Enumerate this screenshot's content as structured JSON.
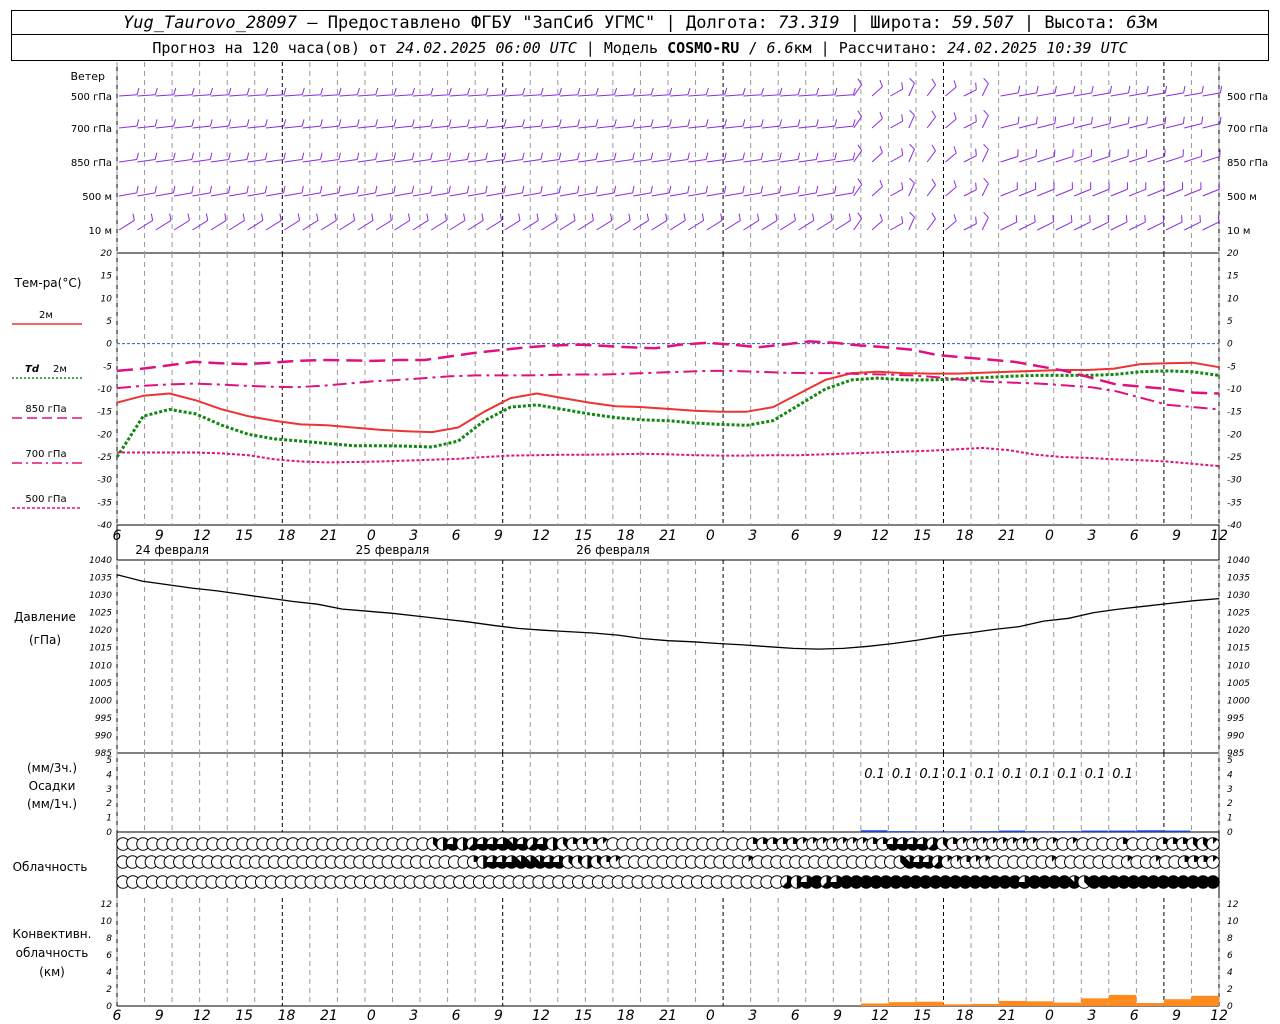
{
  "header": {
    "station": "Yug_Taurovo_28097",
    "provider": "– Предоставлено ФГБУ \"ЗапСиб УГМС\"",
    "lon_label": "Долгота:",
    "lon": "73.319",
    "lat_label": "Широта:",
    "lat": "59.507",
    "alt_label": "Высота:",
    "alt": "63",
    "alt_unit": "м",
    "forecast_prefix": "Прогноз на 120 часа(ов) от",
    "forecast_date": "24.02.2025 06:00 UTC",
    "model_label": "Модель",
    "model": "COSMO-RU",
    "model_res": "6.6",
    "model_res_unit": "км",
    "calc_label": "Рассчитано:",
    "calc_date": "24.02.2025 10:39 UTC"
  },
  "time_axis": {
    "hour_labels": [
      "6",
      "9",
      "12",
      "15",
      "18",
      "21",
      "0",
      "3",
      "6",
      "9",
      "12",
      "15",
      "18",
      "21",
      "0",
      "3",
      "6",
      "9",
      "12",
      "15",
      "18",
      "21",
      "0",
      "3",
      "6",
      "9",
      "12"
    ],
    "day_labels": [
      "24 февраля",
      "25 февраля",
      "26 февраля"
    ]
  },
  "wind": {
    "title": "Ветер",
    "levels": [
      "500 гПа",
      "700 гПа",
      "850 гПа",
      "500 м",
      "10 м"
    ],
    "color": "#8a2be2"
  },
  "temperature": {
    "title": "Тем-ра(°C)",
    "legend": [
      {
        "label": "2м",
        "color": "#ee3333",
        "style": "solid"
      },
      {
        "label": "Td",
        "label2": "2м",
        "color": "#118811",
        "style": "dotted"
      },
      {
        "label": "850 гПа",
        "color": "#e0117f",
        "style": "dash"
      },
      {
        "label": "700 гПа",
        "color": "#e0117f",
        "style": "dashdot"
      },
      {
        "label": "500 гПа",
        "color": "#e0117f",
        "style": "dot"
      }
    ],
    "yticks": [
      "20",
      "15",
      "10",
      "5",
      "0",
      "-5",
      "-10",
      "-15",
      "-20",
      "-25",
      "-30",
      "-35",
      "-40"
    ]
  },
  "pressure": {
    "title": "Давление",
    "unit": "(гПа)",
    "yticks": [
      "1040",
      "1035",
      "1030",
      "1025",
      "1020",
      "1015",
      "1010",
      "1005",
      "1000",
      "995",
      "990",
      "985"
    ]
  },
  "precip": {
    "unit1": "(мм/3ч.)",
    "title": "Осадки",
    "unit2": "(мм/1ч.)",
    "yticks": [
      "5",
      "4",
      "3",
      "2",
      "1",
      "0"
    ],
    "amount_labels": [
      "0.1",
      "0.1",
      "0.1",
      "0.1",
      "0.1",
      "0.1",
      "0.1",
      "0.1",
      "0.1",
      "0.1"
    ],
    "color": "#1a3fd6"
  },
  "clouds": {
    "title": "Облачность",
    "row_cover_eighths": [
      [
        0,
        0,
        0,
        0,
        0,
        0,
        0,
        0,
        0,
        0,
        0,
        0,
        0,
        0,
        0,
        0,
        0,
        0,
        0,
        0,
        0,
        0,
        0,
        0,
        0,
        0,
        0,
        0,
        0,
        0,
        0,
        3,
        4,
        6,
        4,
        5,
        6,
        6,
        6,
        7,
        6,
        5,
        6,
        4,
        3,
        2,
        2,
        2,
        1,
        0,
        0,
        0,
        0,
        0,
        0,
        0,
        0,
        0,
        0,
        0,
        0,
        0,
        0,
        2,
        2,
        2,
        2,
        2,
        1,
        1,
        1,
        1,
        1,
        1,
        1,
        2,
        2,
        6,
        6,
        6,
        6,
        5,
        3,
        2,
        1,
        1,
        1,
        1,
        1,
        1,
        1,
        1,
        0,
        1,
        0,
        1,
        0,
        0,
        0,
        0,
        2,
        0,
        0,
        0,
        2,
        2,
        2,
        3,
        3,
        1
      ],
      [
        0,
        0,
        0,
        0,
        0,
        0,
        0,
        0,
        0,
        0,
        0,
        0,
        0,
        0,
        0,
        0,
        0,
        0,
        0,
        0,
        0,
        0,
        0,
        0,
        0,
        0,
        0,
        0,
        0,
        0,
        0,
        0,
        0,
        0,
        0,
        0,
        0,
        2,
        4,
        6,
        6,
        6,
        7,
        7,
        7,
        6,
        6,
        3,
        3,
        4,
        3,
        2,
        1,
        0,
        0,
        0,
        0,
        0,
        0,
        0,
        0,
        0,
        0,
        0,
        0,
        0,
        1,
        0,
        0,
        0,
        0,
        0,
        0,
        0,
        0,
        0,
        0,
        0,
        0,
        0,
        0,
        0,
        3,
        7,
        6,
        6,
        5,
        1,
        1,
        2,
        1,
        1,
        0,
        0,
        0,
        0,
        0,
        0,
        1,
        0,
        0,
        0,
        0,
        0,
        0,
        0,
        1,
        0,
        0,
        1,
        0,
        0,
        2,
        2,
        2,
        1
      ],
      [
        0,
        0,
        0,
        0,
        0,
        0,
        0,
        0,
        0,
        0,
        0,
        0,
        0,
        0,
        0,
        0,
        0,
        0,
        0,
        0,
        0,
        0,
        0,
        0,
        0,
        0,
        0,
        0,
        0,
        0,
        0,
        0,
        0,
        0,
        0,
        0,
        0,
        0,
        0,
        0,
        0,
        0,
        0,
        0,
        0,
        0,
        0,
        0,
        0,
        0,
        0,
        0,
        0,
        0,
        0,
        0,
        0,
        0,
        0,
        0,
        0,
        0,
        0,
        0,
        0,
        0,
        0,
        5,
        4,
        6,
        8,
        5,
        6,
        8,
        8,
        8,
        8,
        8,
        8,
        8,
        8,
        8,
        8,
        8,
        8,
        8,
        8,
        8,
        8,
        8,
        8,
        6,
        8,
        8,
        8,
        8,
        7,
        3,
        8,
        8,
        8,
        8,
        8,
        8,
        8,
        8,
        8,
        8,
        8,
        8,
        8
      ]
    ]
  },
  "convective": {
    "title1": "Конвективн.",
    "title2": "облачность",
    "unit": "(км)",
    "yticks": [
      "12",
      "10",
      "8",
      "6",
      "4",
      "2",
      "0"
    ],
    "color": "#ff8a1e"
  },
  "chart_data": {
    "type": "line",
    "x_hours": [
      0,
      3,
      6,
      9,
      12,
      15,
      18,
      21,
      24,
      27,
      30,
      33,
      36,
      39,
      42,
      45,
      48,
      51,
      54,
      57,
      60,
      63,
      66,
      69,
      72,
      75,
      78,
      81,
      84,
      87,
      90,
      93,
      96,
      99,
      102,
      105,
      108,
      111,
      114,
      117,
      120
    ],
    "x_tick_labels": [
      "6",
      "9",
      "12",
      "15",
      "18",
      "21",
      "0",
      "3",
      "6",
      "9",
      "12",
      "15",
      "18",
      "21",
      "0",
      "3",
      "6",
      "9",
      "12",
      "15",
      "18",
      "21",
      "0",
      "3",
      "6",
      "9",
      "12"
    ],
    "series": [
      {
        "name": "2м",
        "unit": "°C",
        "values": [
          -13,
          -11.5,
          -11,
          -12.5,
          -14.5,
          -16,
          -17,
          -17.8,
          -18,
          -18.5,
          -19,
          -19.3,
          -19.5,
          -18.5,
          -15,
          -12,
          -11,
          -12,
          -13,
          -13.8,
          -14,
          -14.4,
          -14.8,
          -15,
          -15,
          -14,
          -11,
          -8,
          -6.5,
          -6.2,
          -6.5,
          -6.6,
          -6.6,
          -6.4,
          -6.2,
          -6,
          -5.8,
          -5.8,
          -5.5,
          -4.5,
          -4.3,
          -4.2,
          -5.2
        ]
      },
      {
        "name": "Td 2м",
        "unit": "°C",
        "values": [
          -25,
          -16,
          -14.5,
          -15.5,
          -18,
          -20,
          -21,
          -21.5,
          -22,
          -22.5,
          -22.5,
          -22.6,
          -22.8,
          -21.5,
          -17,
          -14,
          -13.5,
          -14.5,
          -15.5,
          -16.3,
          -16.8,
          -17,
          -17.5,
          -17.8,
          -18,
          -17,
          -13.5,
          -10,
          -8,
          -7.6,
          -8,
          -8,
          -7.8,
          -7.5,
          -7.2,
          -7,
          -7,
          -7,
          -6.8,
          -6.2,
          -6,
          -6.2,
          -7
        ]
      },
      {
        "name": "850 гПа",
        "unit": "°C",
        "values": [
          -6,
          -5.5,
          -4.8,
          -4,
          -4.3,
          -4.5,
          -4.2,
          -3.8,
          -3.6,
          -3.7,
          -3.8,
          -3.6,
          -3.6,
          -2.8,
          -2,
          -1.4,
          -0.8,
          -0.4,
          -0.2,
          -0.5,
          -0.8,
          -1,
          -0.2,
          0.2,
          -0.2,
          -0.8,
          -0.2,
          0.5,
          0.2,
          -0.4,
          -0.8,
          -1.3,
          -2.5,
          -3,
          -3.5,
          -4,
          -5,
          -6,
          -7.5,
          -9,
          -9.5,
          -10,
          -10.8,
          -11
        ]
      },
      {
        "name": "700 гПа",
        "unit": "°C",
        "values": [
          -9.8,
          -9.3,
          -9,
          -8.8,
          -9,
          -9.3,
          -9.5,
          -9.6,
          -9.3,
          -8.8,
          -8.3,
          -8,
          -7.6,
          -7.2,
          -7,
          -7,
          -7,
          -6.9,
          -6.8,
          -6.8,
          -6.6,
          -6.4,
          -6.2,
          -6,
          -6,
          -6.2,
          -6.4,
          -6.5,
          -6.5,
          -6.7,
          -6.8,
          -7,
          -7.4,
          -8,
          -8.4,
          -8.6,
          -8.8,
          -9.2,
          -9.6,
          -10.5,
          -12,
          -13.5,
          -14,
          -14.5
        ]
      },
      {
        "name": "500 гПа",
        "unit": "°C",
        "values": [
          -24,
          -24,
          -24,
          -24,
          -24.2,
          -24.6,
          -25.5,
          -26,
          -26.2,
          -26.1,
          -26,
          -25.8,
          -25.6,
          -25.4,
          -25,
          -24.7,
          -24.6,
          -24.5,
          -24.5,
          -24.4,
          -24.3,
          -24.4,
          -24.6,
          -24.7,
          -24.7,
          -24.6,
          -24.6,
          -24.4,
          -24.2,
          -24,
          -23.8,
          -23.6,
          -23.3,
          -23,
          -23.5,
          -24.5,
          -25,
          -25.2,
          -25.5,
          -25.7,
          -26,
          -26.5,
          -27
        ]
      },
      {
        "name": "Давление",
        "unit": "гПа",
        "values": [
          1035.8,
          1034,
          1033,
          1032,
          1031.2,
          1030.2,
          1029.2,
          1028.2,
          1027.4,
          1026,
          1025.4,
          1024.8,
          1024,
          1023.2,
          1022.4,
          1021.4,
          1020.5,
          1020,
          1019.6,
          1019.2,
          1018.6,
          1017.6,
          1017,
          1016.7,
          1016.2,
          1015.8,
          1015.3,
          1014.8,
          1014.6,
          1014.8,
          1015.4,
          1016.2,
          1017.2,
          1018.4,
          1019.2,
          1020.2,
          1021,
          1022.6,
          1023.4,
          1025,
          1026,
          1026.8,
          1027.6,
          1028.4,
          1029
        ]
      }
    ],
    "precip_bars": [
      {
        "x_from": 81,
        "x_to": 84,
        "mm": 0.12
      },
      {
        "x_from": 84,
        "x_to": 87,
        "mm": 0.06
      },
      {
        "x_from": 87,
        "x_to": 90,
        "mm": 0.05
      },
      {
        "x_from": 90,
        "x_to": 93,
        "mm": 0.05
      },
      {
        "x_from": 93,
        "x_to": 96,
        "mm": 0.06
      },
      {
        "x_from": 96,
        "x_to": 99,
        "mm": 0.1
      },
      {
        "x_from": 99,
        "x_to": 102,
        "mm": 0.06
      },
      {
        "x_from": 102,
        "x_to": 105,
        "mm": 0.06
      },
      {
        "x_from": 105,
        "x_to": 108,
        "mm": 0.1
      },
      {
        "x_from": 108,
        "x_to": 111,
        "mm": 0.1
      },
      {
        "x_from": 111,
        "x_to": 114,
        "mm": 0.12
      },
      {
        "x_from": 114,
        "x_to": 117,
        "mm": 0.1
      }
    ],
    "convective_bars": [
      {
        "x_from": 81,
        "x_to": 84,
        "km": 0.3
      },
      {
        "x_from": 84,
        "x_to": 87,
        "km": 0.45
      },
      {
        "x_from": 87,
        "x_to": 90,
        "km": 0.5
      },
      {
        "x_from": 90,
        "x_to": 93,
        "km": 0.2
      },
      {
        "x_from": 93,
        "x_to": 96,
        "km": 0.25
      },
      {
        "x_from": 96,
        "x_to": 99,
        "km": 0.6
      },
      {
        "x_from": 99,
        "x_to": 102,
        "km": 0.55
      },
      {
        "x_from": 102,
        "x_to": 105,
        "km": 0.4
      },
      {
        "x_from": 105,
        "x_to": 108,
        "km": 0.9
      },
      {
        "x_from": 108,
        "x_to": 111,
        "km": 1.3
      },
      {
        "x_from": 111,
        "x_to": 114,
        "km": 0.35
      },
      {
        "x_from": 114,
        "x_to": 117,
        "km": 0.8
      },
      {
        "x_from": 117,
        "x_to": 120,
        "km": 1.2
      }
    ],
    "temp_ylim": [
      -40,
      20
    ],
    "pressure_ylim": [
      985,
      1040
    ],
    "precip_ylim": [
      0,
      5
    ],
    "convective_ylim": [
      0,
      12
    ]
  }
}
